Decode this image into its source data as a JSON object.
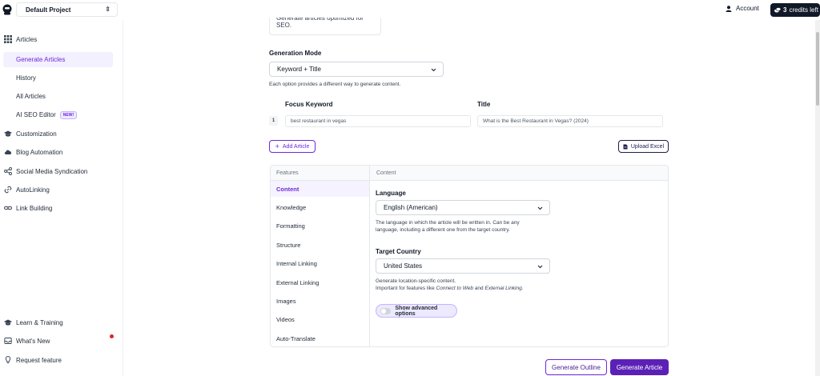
{
  "topbar": {
    "project_name": "Default Project",
    "account_label": "Account",
    "credits_count": "3",
    "credits_suffix": "credits left"
  },
  "sidebar": {
    "articles": "Articles",
    "generate_articles": "Generate Articles",
    "history": "History",
    "all_articles": "All Articles",
    "ai_seo_editor": "AI SEO Editor",
    "new_badge": "NEW!",
    "customization": "Customization",
    "blog_automation": "Blog Automation",
    "social_media": "Social Media Syndication",
    "autolinking": "AutoLinking",
    "link_building": "Link Building",
    "learn_training": "Learn & Training",
    "whats_new": "What's New",
    "request_feature": "Request feature"
  },
  "main": {
    "description_snippet": "Generate articles optimized for SEO.",
    "generation_mode_label": "Generation Mode",
    "generation_mode_value": "Keyword + Title",
    "generation_mode_help": "Each option provides a different way to generate content.",
    "focus_keyword_header": "Focus Keyword",
    "title_header": "Title",
    "row_number": "1",
    "focus_keyword_value": "best restaurant in vegas",
    "title_value": "What is the Best Restaurant in Vegas? (2024)",
    "add_article": "Add Article",
    "upload_excel": "Upload Excel"
  },
  "panel": {
    "features_header": "Features",
    "content_header": "Content",
    "features": [
      "Content",
      "Knowledge",
      "Formatting",
      "Structure",
      "Internal Linking",
      "External Linking",
      "Images",
      "Videos",
      "Auto-Translate"
    ],
    "language_label": "Language",
    "language_value": "English (American)",
    "language_help_1": "The language in which the article will be written in. Can be any",
    "language_help_2": "language, including a different one from the target country.",
    "country_label": "Target Country",
    "country_value": "United States",
    "country_help_1": "Generate location-specific content.",
    "country_help_2_pre": "Important for features like ",
    "country_help_2_em1": "Connect to Web",
    "country_help_2_mid": " and ",
    "country_help_2_em2": "External Linking",
    "country_help_2_end": ".",
    "advanced_label": "Show advanced options"
  },
  "actions": {
    "generate_outline": "Generate Outline",
    "generate_article": "Generate Article"
  },
  "colors": {
    "accent": "#6d28d9",
    "primary_button": "#5b21b6",
    "credits_bg": "#111827",
    "notification_dot": "#dc2626"
  }
}
